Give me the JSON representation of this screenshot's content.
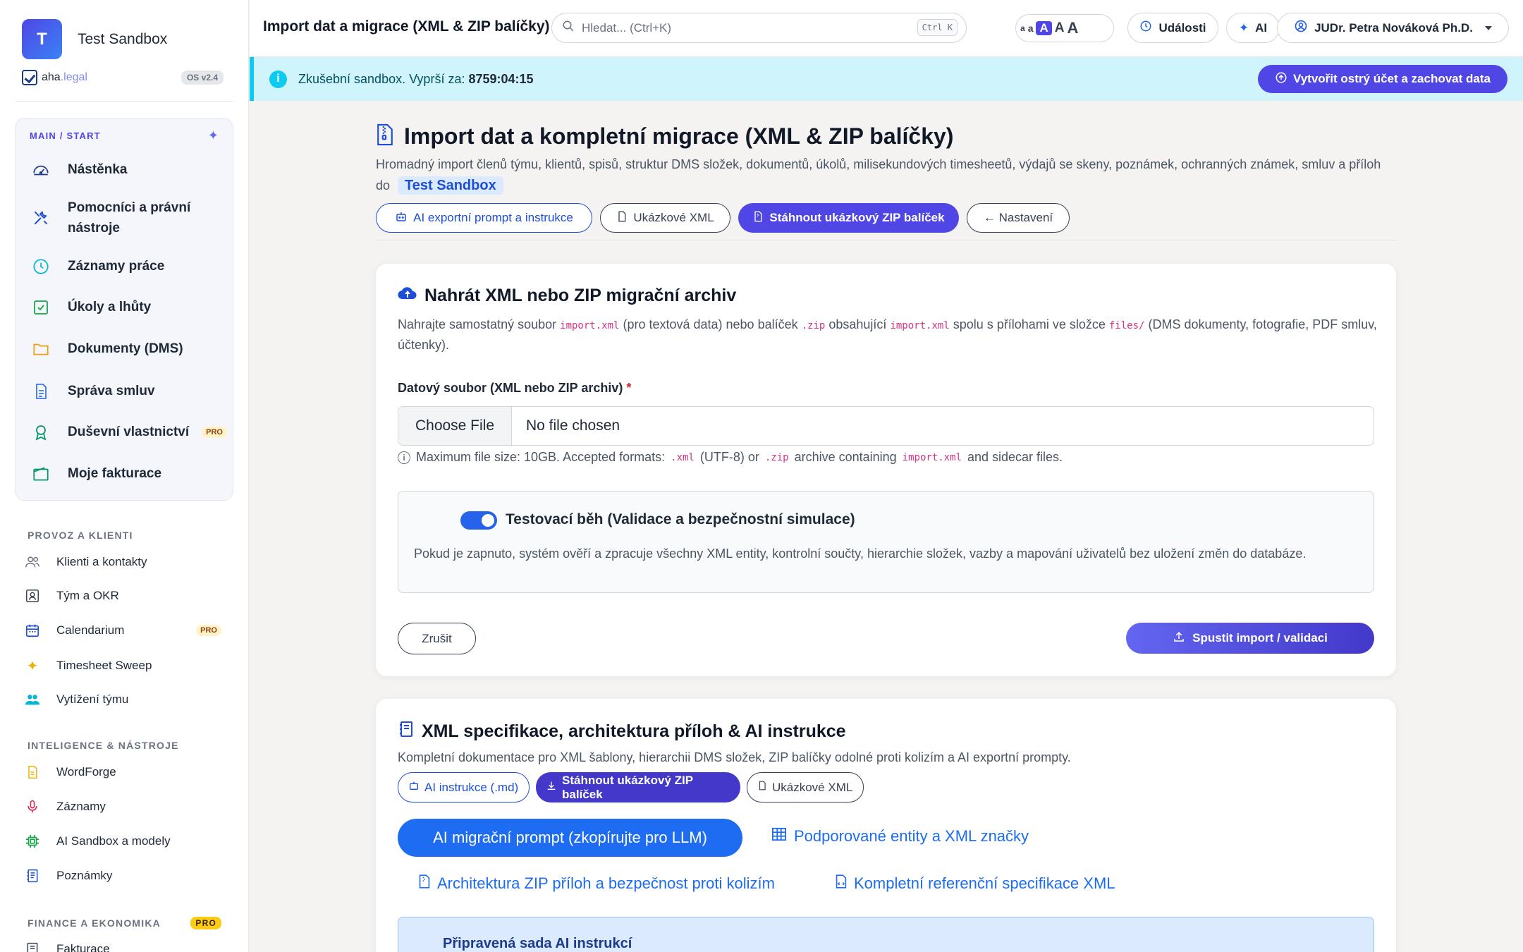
{
  "brand": {
    "initial": "T",
    "name": "Test Sandbox",
    "sub_aha": "aha",
    "sub_legal": ".legal",
    "version": "OS v2.4"
  },
  "sidebar": {
    "main_title": "MAIN / START",
    "main_items": [
      {
        "label": "Nástěnka",
        "icon": "gauge-icon"
      },
      {
        "label": "Pomocníci a právní nástroje",
        "icon": "tools-icon"
      },
      {
        "label": "Záznamy práce",
        "icon": "clock-icon"
      },
      {
        "label": "Úkoly a lhůty",
        "icon": "checkbox-icon"
      },
      {
        "label": "Dokumenty (DMS)",
        "icon": "folder-icon"
      },
      {
        "label": "Správa smluv",
        "icon": "document-icon"
      },
      {
        "label": "Duševní vlastnictví",
        "icon": "award-icon",
        "badge": "PRO"
      },
      {
        "label": "Moje fakturace",
        "icon": "wallet-icon"
      }
    ],
    "groups": [
      {
        "title": "PROVOZ A KLIENTI",
        "items": [
          {
            "label": "Klienti a kontakty",
            "icon": "people-icon"
          },
          {
            "label": "Tým a OKR",
            "icon": "id-card-icon"
          },
          {
            "label": "Calendarium",
            "icon": "calendar-icon",
            "badge": "PRO"
          },
          {
            "label": "Timesheet Sweep",
            "icon": "sparkle-icon"
          },
          {
            "label": "Vytížení týmu",
            "icon": "team-icon"
          }
        ]
      },
      {
        "title": "INTELIGENCE & NÁSTROJE",
        "items": [
          {
            "label": "WordForge",
            "icon": "file-word-icon"
          },
          {
            "label": "Záznamy",
            "icon": "microphone-icon"
          },
          {
            "label": "AI Sandbox a modely",
            "icon": "cpu-icon"
          },
          {
            "label": "Poznámky",
            "icon": "notebook-icon"
          }
        ]
      },
      {
        "title": "FINANCE A EKONOMIKA",
        "badge": "PRO",
        "items": [
          {
            "label": "Fakturace",
            "icon": "receipt-icon"
          }
        ]
      }
    ]
  },
  "topbar": {
    "title": "Import dat a migrace (XML & ZIP balíčky)",
    "search_placeholder": "Hledat... (Ctrl+K)",
    "search_kbd": "Ctrl K",
    "font_sizes": [
      "a",
      "a",
      "A",
      "A",
      "A"
    ],
    "events_label": "Události",
    "ai_label": "AI",
    "user_label": "JUDr. Petra Nováková Ph.D."
  },
  "banner": {
    "text": "Zkušební sandbox. Vyprší za:",
    "countdown": "8759:04:15",
    "cta": "Vytvořit ostrý účet a zachovat data"
  },
  "header": {
    "title": "Import dat a kompletní migrace (XML & ZIP balíčky)",
    "desc": "Hromadný import členů týmu, klientů, spisů, struktur DMS složek, dokumentů, úkolů, milisekundových timesheetů, výdajů se skeny, poznámek, ochranných známek, smluv a příloh do",
    "tenant": "Test Sandbox",
    "buttons": {
      "ai_prompt": "AI exportní prompt a instrukce",
      "sample_xml": "Ukázkové XML",
      "download_zip": "Stáhnout ukázkový ZIP balíček",
      "settings": "← Nastavení"
    }
  },
  "upload": {
    "title": "Nahrát XML nebo ZIP migrační archiv",
    "desc_1": "Nahrajte samostatný soubor",
    "code_1": "import.xml",
    "desc_2": "(pro textová data) nebo balíček",
    "code_2": ".zip",
    "desc_3": "obsahující",
    "code_3": "import.xml",
    "desc_4": "spolu s přílohami ve složce",
    "code_4": "files/",
    "desc_5": "(DMS dokumenty, fotografie, PDF smluv, účtenky).",
    "field_label": "Datový soubor (XML nebo ZIP archiv)",
    "required_mark": "*",
    "choose_label": "Choose File",
    "no_file": "No file chosen",
    "hint_1": "Maximum file size: 10GB. Accepted formats:",
    "hint_code_1": ".xml",
    "hint_2": "(UTF-8) or",
    "hint_code_2": ".zip",
    "hint_3": "archive containing",
    "hint_code_3": "import.xml",
    "hint_4": "and sidecar files.",
    "test_title": "Testovací běh (Validace a bezpečnostní simulace)",
    "test_desc": "Pokud je zapnuto, systém ověří a zpracuje všechny XML entity, kontrolní součty, hierarchie složek, vazby a mapování uživatelů bez uložení změn do databáze.",
    "test_enabled": true,
    "cancel": "Zrušit",
    "run": "Spustit import / validaci"
  },
  "spec": {
    "title": "XML specifikace, architektura příloh & AI instrukce",
    "desc": "Kompletní dokumentace pro XML šablony, hierarchii DMS složek, ZIP balíčky odolné proti kolizím a AI exportní prompty.",
    "btn_ai": "AI instrukce (.md)",
    "btn_zip": "Stáhnout ukázkový ZIP balíček",
    "btn_xml": "Ukázkové XML",
    "tab_active": "AI migrační prompt (zkopírujte pro LLM)",
    "tab_entities": "Podporované entity a XML značky",
    "tab_zip": "Architektura ZIP příloh a bezpečnost proti kolizím",
    "tab_ref": "Kompletní referenční specifikace XML",
    "prepared_title": "Připravená sada AI instrukcí"
  },
  "colors": {
    "accent": "#4f46e5",
    "link": "#1d6cf2",
    "banner": "#cff4fc"
  }
}
